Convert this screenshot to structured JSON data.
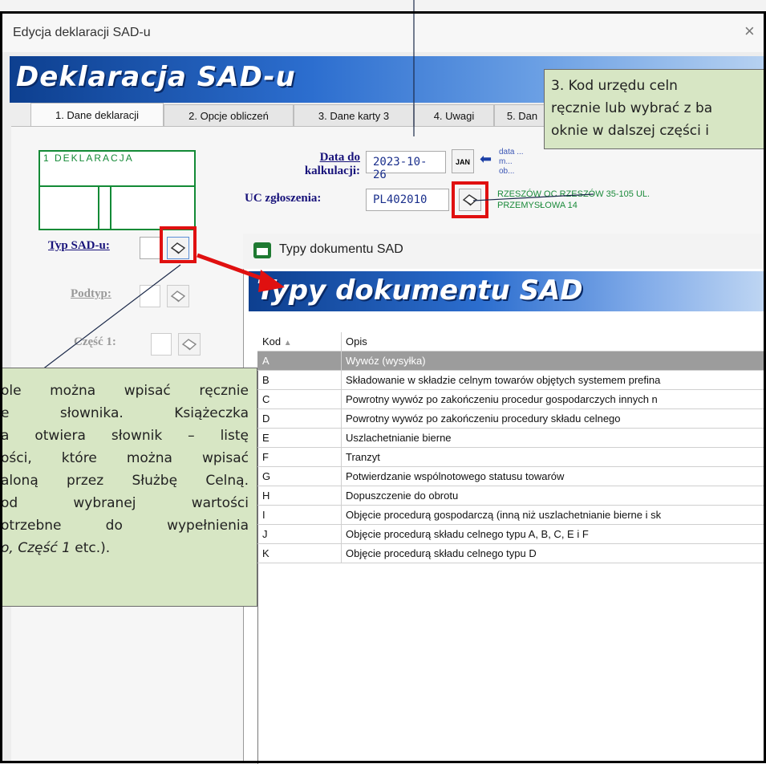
{
  "window": {
    "title": "Edycja deklaracji SAD-u",
    "close": "×"
  },
  "header": {
    "title": "Deklaracja SAD-u"
  },
  "tabs": [
    {
      "label": "1. Dane deklaracji"
    },
    {
      "label": "2. Opcje obliczeń"
    },
    {
      "label": "3. Dane karty 3"
    },
    {
      "label": "4. Uwagi"
    },
    {
      "label": "5. Dan"
    }
  ],
  "declaration_box": {
    "title": "1  DEKLARACJA"
  },
  "fields": {
    "data_label_line1": "Data do",
    "data_label_line2": "kalkulacji:",
    "data_value": "2023-10-26",
    "calendar_label": "JAN",
    "uc_label": "UC zgłoszenia:",
    "uc_value": "PL402010",
    "uc_desc_line1": "RZESZÓW OC RZESZÓW 35-105 UL.",
    "uc_desc_line2": "PRZEMYSŁOWA 14",
    "hint_line1": "data ...",
    "hint_line2": "m...",
    "hint_line3": "ob...",
    "typ_label": "Typ SAD-u:",
    "podtyp_label": "Podtyp:",
    "czesc1_label": "Część 1:"
  },
  "callout_right": {
    "line1": "3. Kod urzędu celn",
    "line2": "ręcznie lub wybrać z ba",
    "line3": "oknie w dalszej części i"
  },
  "callout_left": {
    "line1": "ole można wpisać ręcznie",
    "line2": "e słownika. Książeczka",
    "line3": "a otwiera słownik – listę",
    "line4": "ości, które można wpisać",
    "line5": "aloną przez Służbę Celną.",
    "line6": "od wybranej wartości",
    "line7": "otrzebne do wypełnienia",
    "line8a": "o, Część 1",
    "line8b": " etc.)."
  },
  "dialog": {
    "title": "Typy dokumentu SAD",
    "banner": "Typy dokumentu SAD",
    "columns": {
      "kod": "Kod",
      "opis": "Opis"
    },
    "rows": [
      {
        "kod": "A",
        "opis": "Wywóz (wysyłka)"
      },
      {
        "kod": "B",
        "opis": "Składowanie w składzie celnym towarów objętych systemem prefina"
      },
      {
        "kod": "C",
        "opis": "Powrotny wywóz po zakończeniu procedur gospodarczych innych n"
      },
      {
        "kod": "D",
        "opis": "Powrotny wywóz po zakończeniu procedury składu celnego"
      },
      {
        "kod": "E",
        "opis": "Uszlachetnianie bierne"
      },
      {
        "kod": "F",
        "opis": "Tranzyt"
      },
      {
        "kod": "G",
        "opis": "Potwierdzanie wspólnotowego statusu towarów"
      },
      {
        "kod": "H",
        "opis": "Dopuszczenie do obrotu"
      },
      {
        "kod": "I",
        "opis": "Objęcie procedurą gospodarczą (inną niż uszlachetnianie bierne i sk"
      },
      {
        "kod": "J",
        "opis": "Objęcie procedurą składu celnego typu A, B, C, E i F"
      },
      {
        "kod": "K",
        "opis": "Objęcie procedurą składu celnego typu D"
      }
    ]
  },
  "colors": {
    "banner": "#2c6ecf",
    "callout": "#d7e6c4",
    "highlight": "#e01010",
    "selected_row": "#9c9c9c",
    "label": "#17127a"
  }
}
